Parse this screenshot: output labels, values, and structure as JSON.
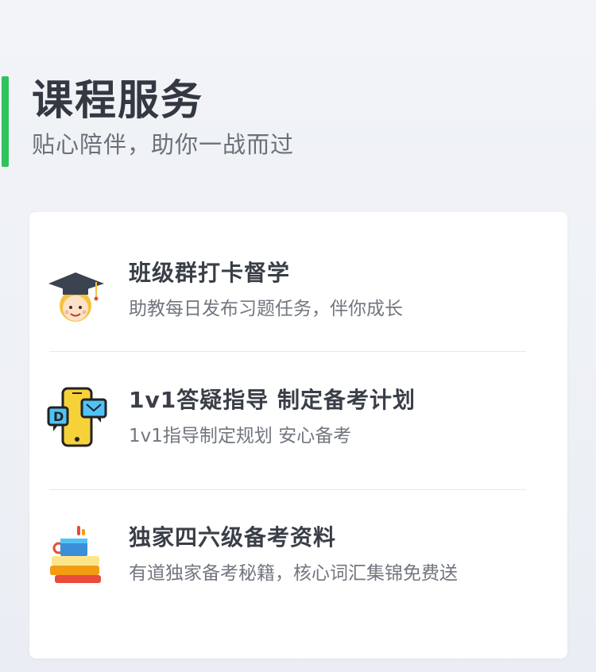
{
  "header": {
    "title": "课程服务",
    "subtitle": "贴心陪伴，助你一战而过",
    "accent_color": "#30c25e"
  },
  "services": [
    {
      "icon": "graduate-student-icon",
      "title": "班级群打卡督学",
      "description": "助教每日发布习题任务，伴你成长"
    },
    {
      "icon": "phone-chat-icon",
      "title": "1v1答疑指导 制定备考计划",
      "description": "1v1指导制定规划 安心备考"
    },
    {
      "icon": "books-coffee-icon",
      "title": "独家四六级备考资料",
      "description": "有道独家备考秘籍，核心词汇集锦免费送"
    }
  ]
}
